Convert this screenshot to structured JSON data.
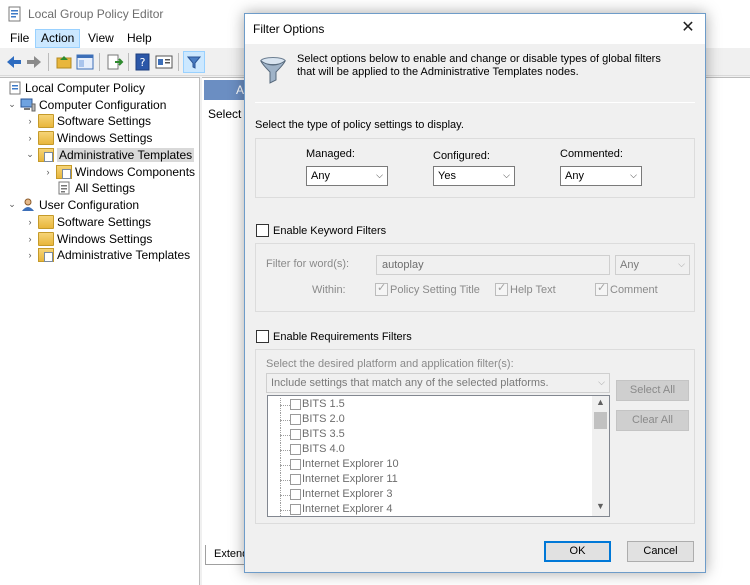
{
  "main_window": {
    "title": "Local Group Policy Editor",
    "menu": [
      "File",
      "Action",
      "View",
      "Help"
    ],
    "active_menu": "Action"
  },
  "tree": {
    "root": "Local Computer Policy",
    "computer_configuration": "Computer Configuration",
    "software_settings": "Software Settings",
    "windows_settings": "Windows Settings",
    "administrative_templates": "Administrative Templates",
    "windows_components": "Windows Components",
    "all_settings": "All Settings",
    "user_configuration": "User Configuration",
    "user_software_settings": "Software Settings",
    "user_windows_settings": "Windows Settings",
    "user_administrative_templates": "Administrative Templates"
  },
  "right_pane": {
    "header_text": "A",
    "select_text": "Select a",
    "extended_tab": "Extend"
  },
  "dialog": {
    "title": "Filter Options",
    "close_glyph": "✕",
    "description": "Select options below to enable and change or disable types of global filters that will be applied to the Administrative Templates nodes.",
    "type_label": "Select the type of policy settings to display.",
    "managed": {
      "label": "Managed:",
      "value": "Any"
    },
    "configured": {
      "label": "Configured:",
      "value": "Yes"
    },
    "commented": {
      "label": "Commented:",
      "value": "Any"
    },
    "keyword": {
      "enable_label": "Enable Keyword Filters",
      "filter_label": "Filter for word(s):",
      "filter_value": "autoplay",
      "match_value": "Any",
      "within_label": "Within:",
      "policy_setting_title": "Policy Setting Title",
      "help_text": "Help Text",
      "comment": "Comment"
    },
    "requirements": {
      "enable_label": "Enable Requirements Filters",
      "platform_label": "Select the desired platform and application filter(s):",
      "match_select": "Include settings that match any of the selected platforms.",
      "select_all": "Select All",
      "clear_all": "Clear All",
      "platforms": [
        "BITS 1.5",
        "BITS 2.0",
        "BITS 3.5",
        "BITS 4.0",
        "Internet Explorer 10",
        "Internet Explorer 11",
        "Internet Explorer 3",
        "Internet Explorer 4"
      ]
    },
    "ok": "OK",
    "cancel": "Cancel"
  }
}
